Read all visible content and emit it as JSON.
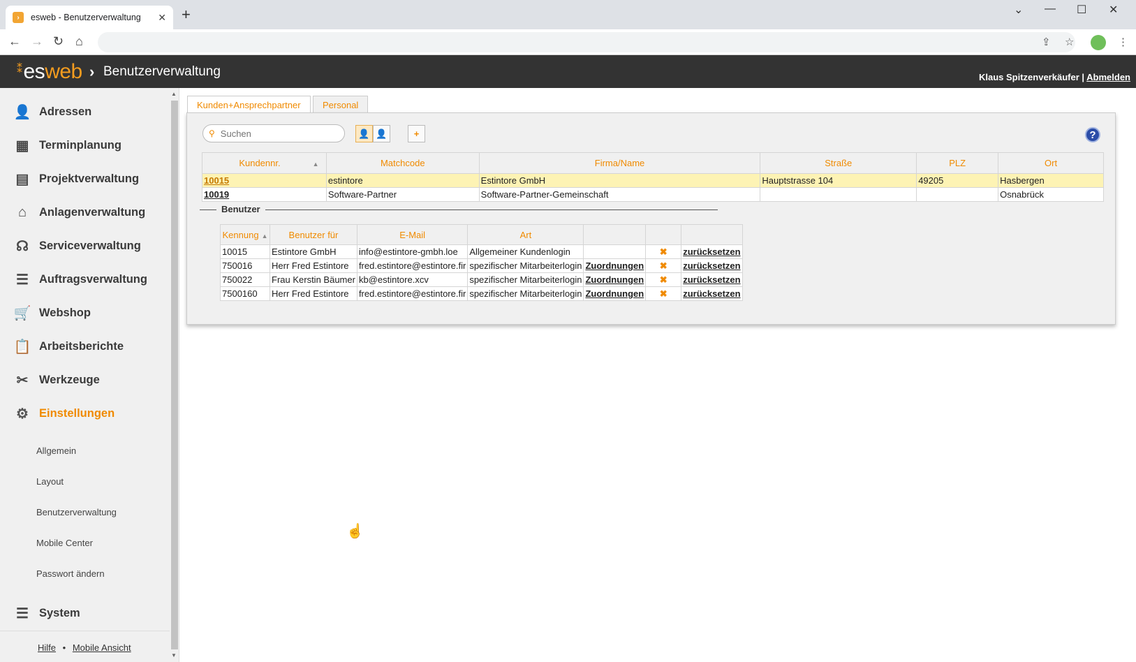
{
  "browser": {
    "tab_title": "esweb - Benutzerverwaltung",
    "tab_close": "✕",
    "new_tab": "+",
    "win_dropdown": "⌄",
    "win_min": "—",
    "win_max": "☐",
    "win_close": "✕",
    "nav_back": "←",
    "nav_forward": "→",
    "nav_reload": "↻",
    "nav_home": "⌂",
    "share": "⇪",
    "star": "☆",
    "menu": "⋮"
  },
  "header": {
    "logo_dots": "⁑",
    "logo_es": "es",
    "logo_web": "web",
    "separator": "›",
    "title": "Benutzerverwaltung",
    "user_name": "Klaus Spitzenverkäufer",
    "user_sep": " | ",
    "logout": "Abmelden"
  },
  "sidebar": {
    "items": [
      {
        "label": "Adressen",
        "icon": "address-book-icon",
        "glyph": "👤"
      },
      {
        "label": "Terminplanung",
        "icon": "calendar-icon",
        "glyph": "▦"
      },
      {
        "label": "Projektverwaltung",
        "icon": "gantt-icon",
        "glyph": "▤"
      },
      {
        "label": "Anlagenverwaltung",
        "icon": "factory-icon",
        "glyph": "⌂"
      },
      {
        "label": "Serviceverwaltung",
        "icon": "headset-icon",
        "glyph": "☊"
      },
      {
        "label": "Auftragsverwaltung",
        "icon": "list-icon",
        "glyph": "☰"
      },
      {
        "label": "Webshop",
        "icon": "cart-icon",
        "glyph": "🛒"
      },
      {
        "label": "Arbeitsberichte",
        "icon": "clipboard-icon",
        "glyph": "📋"
      },
      {
        "label": "Werkzeuge",
        "icon": "tools-icon",
        "glyph": "✂"
      },
      {
        "label": "Einstellungen",
        "icon": "gears-icon",
        "glyph": "⚙"
      },
      {
        "label": "System",
        "icon": "database-icon",
        "glyph": "☰"
      }
    ],
    "subitems": [
      "Allgemein",
      "Layout",
      "Benutzerverwaltung",
      "Mobile Center",
      "Passwort ändern"
    ],
    "footer": {
      "help": "Hilfe",
      "sep": "•",
      "mobile": "Mobile Ansicht"
    },
    "scroll_up": "▲",
    "scroll_down": "▼"
  },
  "tabs": [
    {
      "label": "Kunden+Ansprechpartner"
    },
    {
      "label": "Personal"
    }
  ],
  "toolbar": {
    "search_placeholder": "Suchen",
    "search_icon": "⚲",
    "customer_btn": "👤",
    "employee_btn": "👤",
    "add_btn": "+",
    "help_btn": "?"
  },
  "kunden_table": {
    "headers": [
      "Kundennr.",
      "Matchcode",
      "Firma/Name",
      "Straße",
      "PLZ",
      "Ort"
    ],
    "sort_indicator": "▲",
    "rows": [
      {
        "nr": "10015",
        "matchcode": "estintore",
        "firma": "Estintore GmbH",
        "strasse": "Hauptstrasse 104",
        "plz": "49205",
        "ort": "Hasbergen"
      },
      {
        "nr": "10019",
        "matchcode": "Software-Partner",
        "firma": "Software-Partner-Gemeinschaft",
        "strasse": "",
        "plz": "",
        "ort": "Osnabrück"
      }
    ]
  },
  "benutzer": {
    "legend": "Benutzer",
    "headers": [
      "Kennung",
      "Benutzer für",
      "E-Mail",
      "Art",
      "",
      "",
      ""
    ],
    "sort_indicator": "▲",
    "rows": [
      {
        "kennung": "10015",
        "fuer": "Estintore GmbH",
        "email": "info@estintore-gmbh.loe",
        "art": "Allgemeiner Kundenlogin",
        "zuordnungen": "",
        "del": "✖",
        "reset": "zurücksetzen"
      },
      {
        "kennung": "750016",
        "fuer": "Herr Fred Estintore",
        "email": "fred.estintore@estintore.fir",
        "art": "spezifischer Mitarbeiterlogin",
        "zuordnungen": "Zuordnungen",
        "del": "✖",
        "reset": "zurücksetzen"
      },
      {
        "kennung": "750022",
        "fuer": "Frau Kerstin Bäumer",
        "email": "kb@estintore.xcv",
        "art": "spezifischer Mitarbeiterlogin",
        "zuordnungen": "Zuordnungen",
        "del": "✖",
        "reset": "zurücksetzen"
      },
      {
        "kennung": "7500160",
        "fuer": "Herr Fred Estintore",
        "email": "fred.estintore@estintore.fir",
        "art": "spezifischer Mitarbeiterlogin",
        "zuordnungen": "Zuordnungen",
        "del": "✖",
        "reset": "zurücksetzen"
      }
    ]
  },
  "cursor": "☝",
  "colors": {
    "accent": "#f08a00",
    "header_bg": "#333333",
    "highlight_row": "#fdf3b4",
    "help_blue": "#2b4da8"
  }
}
